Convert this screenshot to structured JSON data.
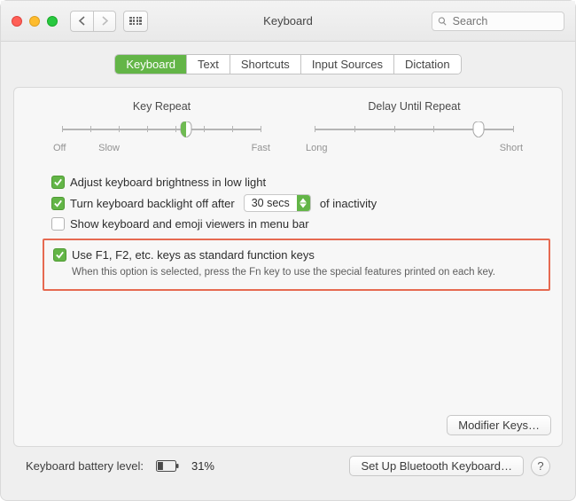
{
  "window": {
    "title": "Keyboard"
  },
  "search": {
    "placeholder": "Search"
  },
  "tabs": [
    {
      "label": "Keyboard",
      "active": true
    },
    {
      "label": "Text"
    },
    {
      "label": "Shortcuts"
    },
    {
      "label": "Input Sources"
    },
    {
      "label": "Dictation"
    }
  ],
  "sliders": {
    "keyRepeat": {
      "title": "Key Repeat",
      "leftLabel": "Off",
      "midLabel": "Slow",
      "rightLabel": "Fast",
      "ticks": 8,
      "valuePct": 62
    },
    "delay": {
      "title": "Delay Until Repeat",
      "leftLabel": "Long",
      "rightLabel": "Short",
      "ticks": 6,
      "valuePct": 82
    }
  },
  "options": {
    "brightness": {
      "checked": true,
      "label": "Adjust keyboard brightness in low light"
    },
    "backlightOff": {
      "checked": true,
      "labelBefore": "Turn keyboard backlight off after",
      "value": "30 secs",
      "labelAfter": "of inactivity"
    },
    "viewers": {
      "checked": false,
      "label": "Show keyboard and emoji viewers in menu bar"
    },
    "fnKeys": {
      "checked": true,
      "label": "Use F1, F2, etc. keys as standard function keys",
      "description": "When this option is selected, press the Fn key to use the special features printed on each key."
    }
  },
  "buttons": {
    "modifierKeys": "Modifier Keys…",
    "bluetooth": "Set Up Bluetooth Keyboard…"
  },
  "footer": {
    "batteryLabel": "Keyboard battery level:",
    "batteryPct": "31%",
    "batteryFillPct": 31
  }
}
